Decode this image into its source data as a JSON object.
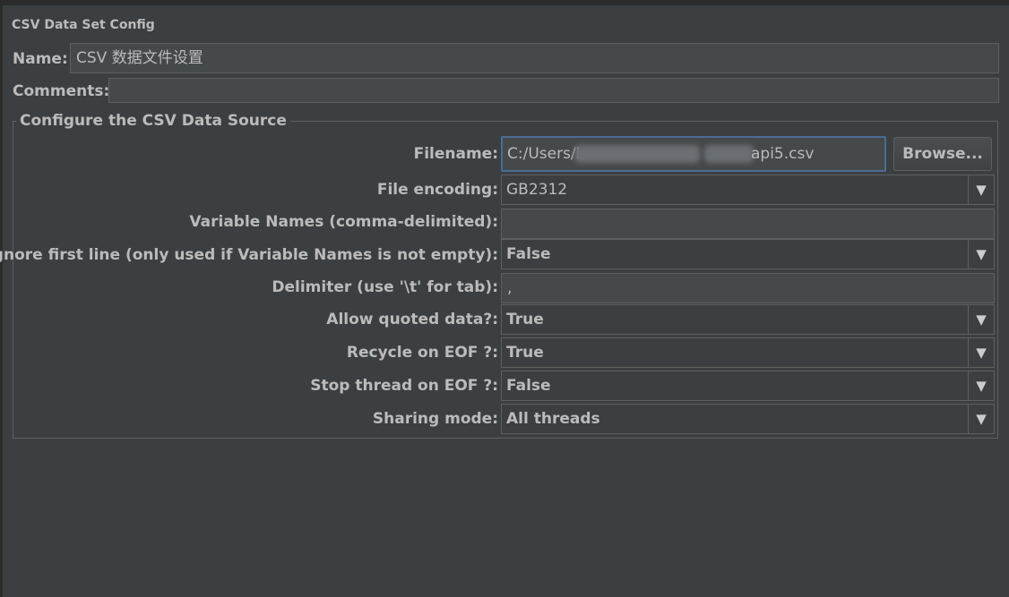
{
  "panel": {
    "title": "CSV Data Set Config",
    "name_label": "Name:",
    "name_value": "CSV 数据文件设置",
    "comments_label": "Comments:",
    "comments_value": ""
  },
  "source": {
    "legend": "Configure the CSV Data Source",
    "filename_label": "Filename:",
    "filename_prefix": "C:/Users/l",
    "filename_suffix": "api5.csv",
    "browse_label": "Browse...",
    "encoding_label": "File encoding:",
    "encoding_value": "GB2312",
    "varnames_label": "Variable Names (comma-delimited):",
    "varnames_value": "",
    "ignore_label": "Ignore first line (only used if Variable Names is not empty):",
    "ignore_value": "False",
    "delimiter_label": "Delimiter (use '\\t' for tab):",
    "delimiter_value": ",",
    "quoted_label": "Allow quoted data?:",
    "quoted_value": "True",
    "recycle_label": "Recycle on EOF ?:",
    "recycle_value": "True",
    "stop_label": "Stop thread on EOF ?:",
    "stop_value": "False",
    "sharing_label": "Sharing mode:",
    "sharing_value": "All threads"
  },
  "icons": {
    "dropdown": "▼"
  }
}
